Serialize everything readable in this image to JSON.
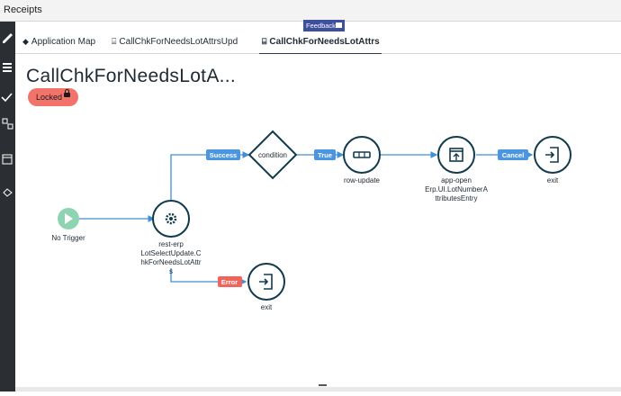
{
  "window": {
    "title": "Receipts"
  },
  "feedback_label": "Feedback",
  "tabs": [
    {
      "label": "Application Map",
      "icon": "diamond-icon"
    },
    {
      "label": "CallChkForNeedsLotAttrsUpd",
      "icon": "flow-icon"
    },
    {
      "label": "CallChkForNeedsLotAttrs",
      "icon": "flow-icon",
      "active": true
    }
  ],
  "flow": {
    "title": "CallChkForNeedsLotA...",
    "locked_label": "Locked",
    "nodes": [
      {
        "id": "no-trigger",
        "label": [
          "No Trigger"
        ],
        "kind": "trigger"
      },
      {
        "id": "rest-erp",
        "label": [
          "rest-erp",
          "LotSelectUpdate.C",
          "hkForNeedsLotAttr",
          "s"
        ],
        "kind": "gear"
      },
      {
        "id": "condition",
        "label": [
          "condition"
        ],
        "kind": "diamond"
      },
      {
        "id": "row-update",
        "label": [
          "row-update"
        ],
        "kind": "row"
      },
      {
        "id": "app-open",
        "label": [
          "app-open",
          "Erp.UI.LotNumberA",
          "ttributesEntry"
        ],
        "kind": "open"
      },
      {
        "id": "exit-top",
        "label": [
          "exit"
        ],
        "kind": "exit"
      },
      {
        "id": "exit-bottom",
        "label": [
          "exit"
        ],
        "kind": "exit"
      }
    ],
    "edges": [
      {
        "label": "Success"
      },
      {
        "label": "True"
      },
      {
        "label": "Cancel"
      },
      {
        "label": "Error"
      }
    ]
  },
  "colors": {
    "node_stroke": "#123a4d",
    "edge": "#3f8fd6",
    "edge_label": "#4c95e0",
    "error_label": "#f0645c",
    "trigger": "#8fd4b2",
    "locked_bg": "#f2736a"
  }
}
